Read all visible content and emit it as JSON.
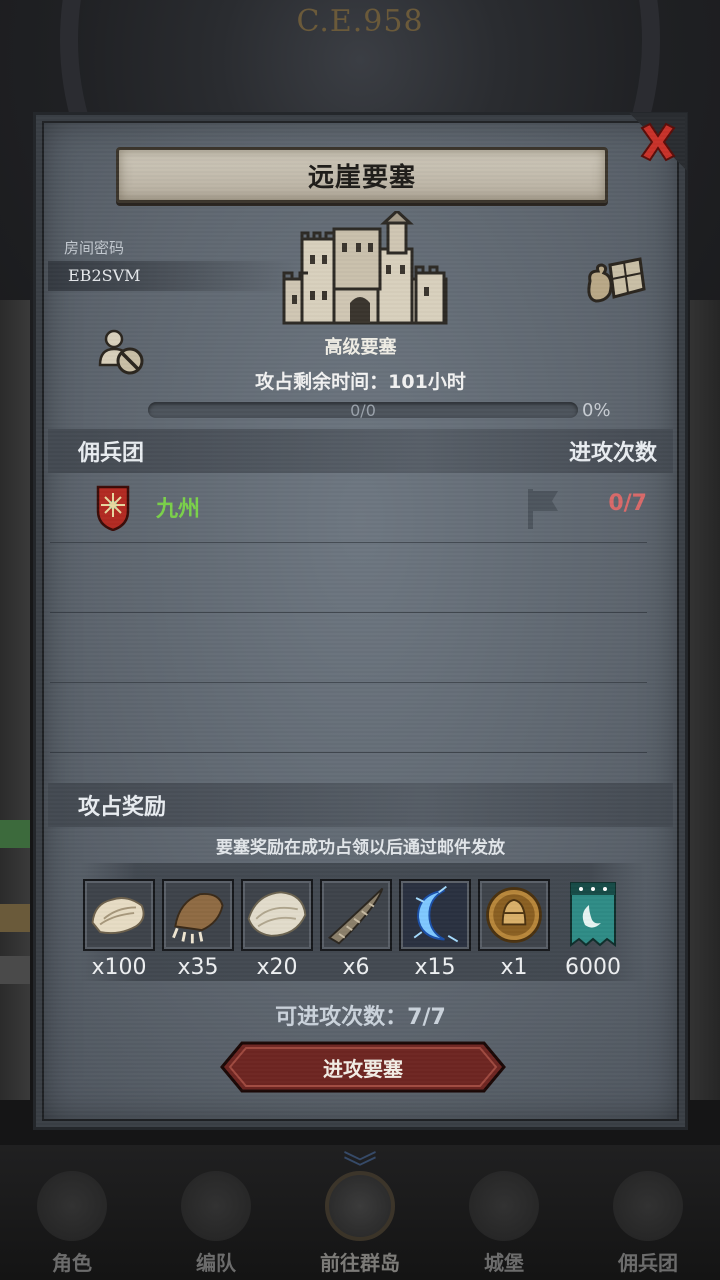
{
  "background": {
    "era_text": "C.E.958"
  },
  "dialog": {
    "title": "远崖要塞",
    "room_code_label": "房间密码",
    "room_code": "EB2SVM",
    "fortress_grade": "高级要塞",
    "remaining_time": "攻占剩余时间：101小时",
    "progress": {
      "text": "0/0",
      "fraction": 0,
      "percent_label": "0%"
    },
    "icons": {
      "close": "close-x-icon",
      "supplies": "supply-bag-crate-icon",
      "person": "person-forbidden-icon",
      "castle": "castle-icon"
    }
  },
  "mercenary_section": {
    "left_header": "佣兵团",
    "right_header": "进攻次数",
    "rows": [
      {
        "name": "九州",
        "attacks": "0/7",
        "name_color": "#7bd24a",
        "count_color": "#d96a6a"
      }
    ],
    "empty_rows": 3
  },
  "rewards_section": {
    "header": "攻占奖励",
    "note": "要塞奖励在成功占领以后通过邮件发放",
    "items": [
      {
        "icon": "fur-pelt-icon",
        "qty": "x100"
      },
      {
        "icon": "beast-claw-icon",
        "qty": "x35"
      },
      {
        "icon": "scale-hide-icon",
        "qty": "x20"
      },
      {
        "icon": "horn-icon",
        "qty": "x6"
      },
      {
        "icon": "blue-crescent-rune-icon",
        "qty": "x15"
      },
      {
        "icon": "knight-helmet-coin-icon",
        "qty": "x1"
      },
      {
        "icon": "guild-banner-icon",
        "qty": "6000"
      }
    ]
  },
  "attacks_available": "可进攻次数：7/7",
  "attack_button_label": "进攻要塞",
  "bottom_nav": {
    "items": [
      {
        "label": "角色",
        "active": false
      },
      {
        "label": "编队",
        "active": false
      },
      {
        "label": "前往群岛",
        "active": true
      },
      {
        "label": "城堡",
        "active": false
      },
      {
        "label": "佣兵团",
        "active": false
      }
    ]
  },
  "colors": {
    "accent_green": "#7bd24a",
    "accent_red": "#d96a6a",
    "button_red": "#7a2a2a",
    "close_red": "#c8322a"
  }
}
